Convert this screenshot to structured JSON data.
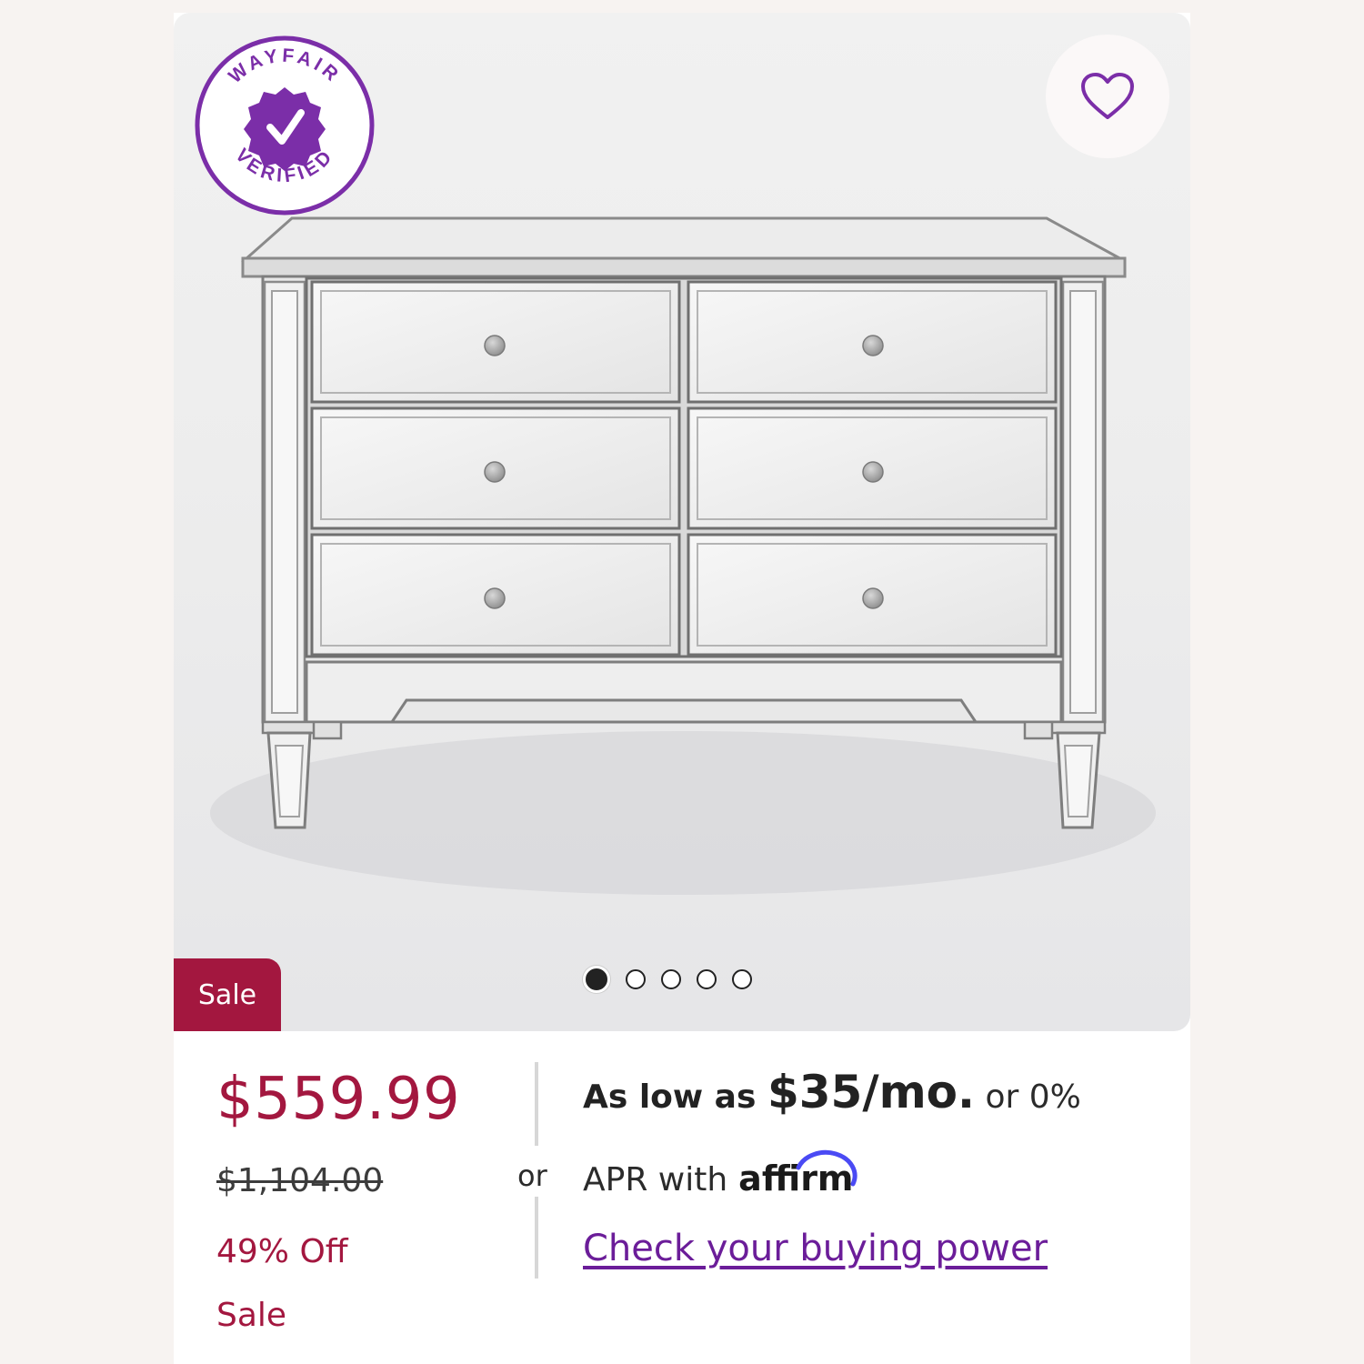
{
  "product": {
    "badge": {
      "top_text": "WAYFAIR",
      "bottom_text": "VERIFIED",
      "icon": "check-seal-icon",
      "color": "#7b2ea8"
    },
    "favorite_icon": "heart-outline-icon",
    "sale_tag": "Sale",
    "carousel": {
      "total": 5,
      "active": 1
    }
  },
  "pricing": {
    "price": "$559.99",
    "was_price": "$1,104.00",
    "discount": "49% Off",
    "sale_label": "Sale",
    "accent_color": "#a3173f"
  },
  "financing": {
    "separator": "or",
    "line1_prefix": "As low as ",
    "line1_amount": "$35/mo.",
    "line1_suffix": " or 0%",
    "line2_text": "APR with",
    "affirm_logo": "affirm",
    "link": "Check your buying power",
    "link_color": "#6b1d99"
  }
}
